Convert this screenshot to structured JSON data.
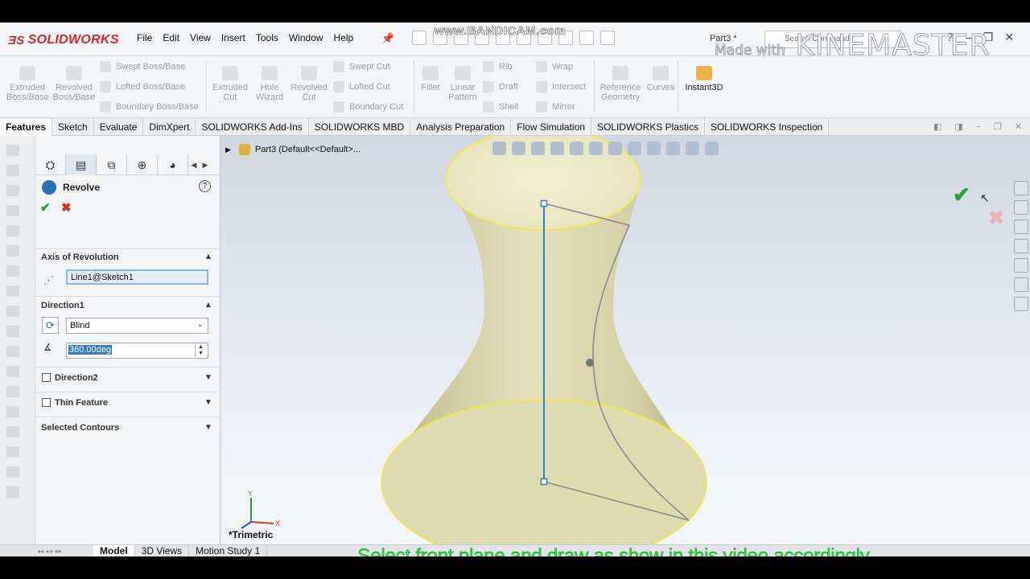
{
  "recording": {
    "bandicam": "www.BANDICAM.com",
    "kinemaster_prefix": "Made with",
    "kinemaster_brand": "KINEMASTER"
  },
  "app": {
    "logo": "SOLIDWORKS",
    "menus": [
      "File",
      "Edit",
      "View",
      "Insert",
      "Tools",
      "Window",
      "Help"
    ],
    "document": "Part3 *",
    "search_placeholder": "Search Commands"
  },
  "ribbon": {
    "boss": {
      "extruded": "Extruded Boss/Base",
      "revolved": "Revolved Boss/Base",
      "swept": "Swept Boss/Base",
      "lofted": "Lofted Boss/Base",
      "boundary": "Boundary Boss/Base"
    },
    "cut": {
      "extruded": "Extruded Cut",
      "hole": "Hole Wizard",
      "revolved": "Revolved Cut",
      "swept": "Swept Cut",
      "lofted": "Lofted Cut",
      "boundary": "Boundary Cut"
    },
    "features": {
      "fillet": "Fillet",
      "pattern": "Linear Pattern",
      "rib": "Rib",
      "draft": "Draft",
      "shell": "Shell",
      "wrap": "Wrap",
      "intersect": "Intersect",
      "mirror": "Mirror"
    },
    "refgeo": "Reference Geometry",
    "curves": "Curves",
    "instant3d": "Instant3D"
  },
  "tabs": [
    "Features",
    "Sketch",
    "Evaluate",
    "DimXpert",
    "SOLIDWORKS Add-Ins",
    "SOLIDWORKS MBD",
    "Analysis Preparation",
    "Flow Simulation",
    "SOLIDWORKS Plastics",
    "SOLIDWORKS Inspection"
  ],
  "pm": {
    "title": "Revolve",
    "axis_section": "Axis of Revolution",
    "axis_value": "Line1@Sketch1",
    "direction1_section": "Direction1",
    "direction1_type": "Blind",
    "angle": "360.00deg",
    "direction2": "Direction2",
    "thin_feature": "Thin Feature",
    "selected_contours": "Selected Contours"
  },
  "viewport": {
    "breadcrumb": "Part3  (Default<<Default>...",
    "view_name": "*Trimetric",
    "triad": {
      "x": "X",
      "y": "Y"
    }
  },
  "bottom_tabs": [
    "Model",
    "3D Views",
    "Motion Study 1"
  ],
  "subtitle": "Select front plane and draw as show in this video accordingly",
  "colors": {
    "accept": "#2aa035",
    "cancel": "#d62a24",
    "surface": "#dedbb0",
    "edge": "#f1ea3a",
    "sketch": "#2a7fd4",
    "subtitle": "#22e832"
  }
}
